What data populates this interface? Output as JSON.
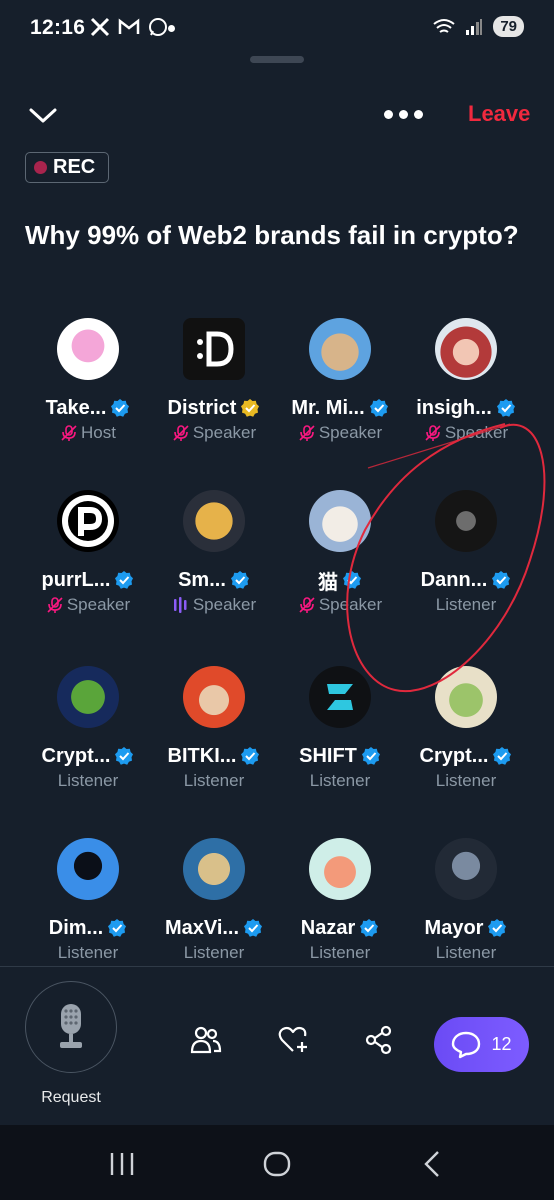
{
  "status_bar": {
    "time": "12:16",
    "battery": "79",
    "wifi_label": "6"
  },
  "header": {
    "leave_label": "Leave",
    "rec_label": "REC",
    "accent_color": "#f0293e"
  },
  "space": {
    "title": "Why 99% of Web2 brands fail in crypto?"
  },
  "participants": [
    {
      "name": "Take...",
      "role": "Host",
      "verified": "blue",
      "muted": true,
      "avatar": "cupcake-avatar"
    },
    {
      "name": "District",
      "role": "Speaker",
      "verified": "gold",
      "muted": true,
      "avatar": "district-logo-avatar"
    },
    {
      "name": "Mr. Mi...",
      "role": "Speaker",
      "verified": "blue",
      "muted": true,
      "avatar": "cat-avatar"
    },
    {
      "name": "insigh...",
      "role": "Speaker",
      "verified": "blue",
      "muted": true,
      "avatar": "red-panda-avatar"
    },
    {
      "name": "purrL...",
      "role": "Speaker",
      "verified": "blue",
      "muted": true,
      "avatar": "purr-logo-avatar"
    },
    {
      "name": "Sm...",
      "role": "Speaker",
      "verified": "blue",
      "speaking": true,
      "avatar": "doge-avatar"
    },
    {
      "name": "猫",
      "role": "Speaker",
      "verified": "blue",
      "muted": true,
      "avatar": "anime-cat-avatar"
    },
    {
      "name": "Dann...",
      "role": "Listener",
      "verified": "blue",
      "avatar": "man-glasses-avatar"
    },
    {
      "name": "Crypt...",
      "role": "Listener",
      "verified": "blue",
      "avatar": "pepe-avatar"
    },
    {
      "name": "BITKI...",
      "role": "Listener",
      "verified": "blue",
      "avatar": "king-avatar"
    },
    {
      "name": "SHIFT",
      "role": "Listener",
      "verified": "blue",
      "avatar": "shift-logo-avatar"
    },
    {
      "name": "Crypt...",
      "role": "Listener",
      "verified": "blue",
      "avatar": "frog-avatar"
    },
    {
      "name": "Dim...",
      "role": "Listener",
      "verified": "blue",
      "avatar": "silhouette-avatar"
    },
    {
      "name": "MaxVi...",
      "role": "Listener",
      "verified": "blue",
      "avatar": "ninja-avatar"
    },
    {
      "name": "Nazar",
      "role": "Listener",
      "verified": "blue",
      "avatar": "monkey-avatar"
    },
    {
      "name": "Mayor",
      "role": "Listener",
      "verified": "blue",
      "avatar": "wolf-suit-avatar"
    }
  ],
  "bottom_bar": {
    "request_label": "Request",
    "chat_count": "12"
  }
}
